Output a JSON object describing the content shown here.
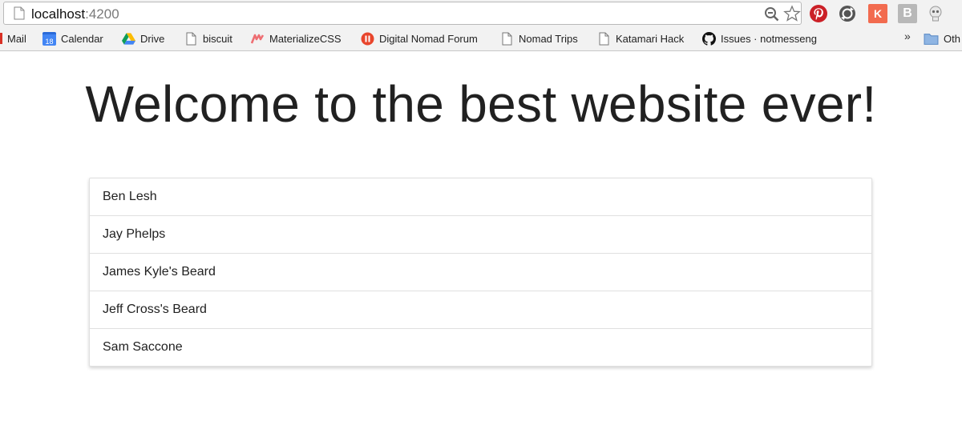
{
  "browser": {
    "url_host": "localhost",
    "url_port": ":4200",
    "bookmarks": {
      "mail": "Mail",
      "calendar": "Calendar",
      "calendar_date": "18",
      "drive": "Drive",
      "biscuit": "biscuit",
      "materializecss": "MaterializeCSS",
      "digital_nomad_forum": "Digital Nomad Forum",
      "nomad_trips": "Nomad Trips",
      "katamari_hack": "Katamari Hack",
      "issues": "Issues · notmesseng",
      "more": "»",
      "other": "Oth"
    },
    "extensions": {
      "kx_label": "K",
      "b_label": "B"
    },
    "colors": {
      "pinterest": "#cb2027",
      "calendar_blue": "#4285f4",
      "kx_orange": "#f26b4f",
      "materialize_red": "#ee6e73",
      "dnf_red": "#e8452c"
    }
  },
  "page": {
    "title": "Welcome to the best website ever!",
    "items": [
      "Ben Lesh",
      "Jay Phelps",
      "James Kyle's Beard",
      "Jeff Cross's Beard",
      "Sam Saccone"
    ]
  }
}
